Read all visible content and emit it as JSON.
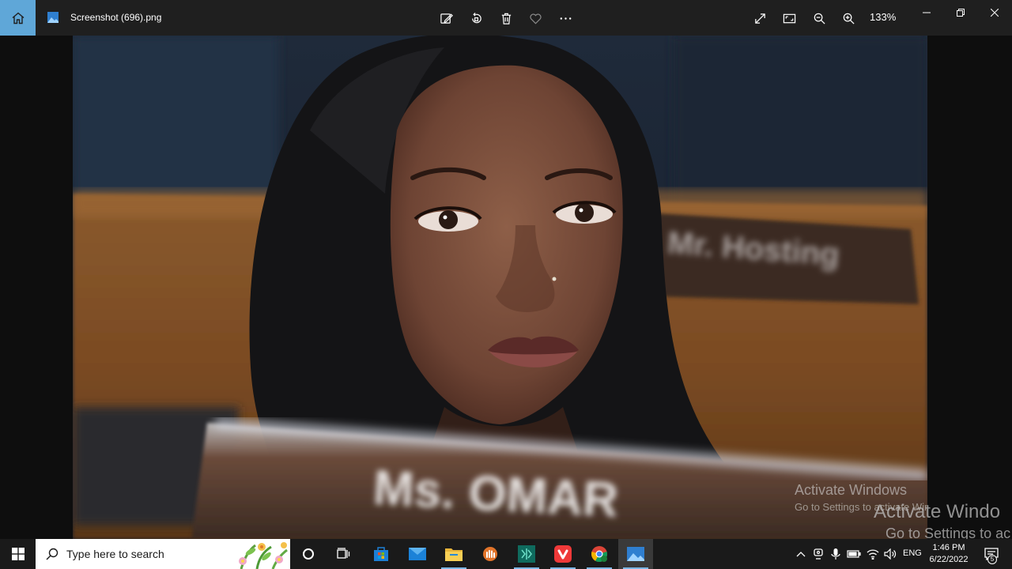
{
  "app": {
    "file_title": "Screenshot (696).png",
    "zoom_level": "133%"
  },
  "toolbar": {
    "icons": [
      "edit-image-icon",
      "rotate-icon",
      "delete-icon",
      "favorite-icon",
      "more-icon"
    ],
    "right_icons": [
      "fullscreen-icon",
      "fit-to-window-icon",
      "zoom-out-icon",
      "zoom-in-icon"
    ]
  },
  "photo": {
    "placard_right_text": "Mr. Hosting",
    "placard_front_text": "Ms. OMAR"
  },
  "watermark": {
    "inner_title": "Activate Windows",
    "inner_subtitle": "Go to Settings to activate Windows.",
    "outer_title": "Activate Windo",
    "outer_subtitle": "Go to Settings to ac"
  },
  "taskbar": {
    "search_placeholder": "Type here to search",
    "language": "ENG",
    "time": "1:46 PM",
    "date": "6/22/2022",
    "notification_count": "5",
    "apps": [
      "cortana-icon",
      "task-view-icon",
      "microsoft-store-icon",
      "mail-icon",
      "file-explorer-icon",
      "hand-app-icon",
      "code-editor-icon",
      "vivaldi-icon",
      "chrome-icon",
      "photos-icon"
    ]
  },
  "colors": {
    "home_accent": "#5fa7d8",
    "titlebar_bg": "#1f1f1f",
    "taskbar_bg": "#1a1a1a"
  }
}
